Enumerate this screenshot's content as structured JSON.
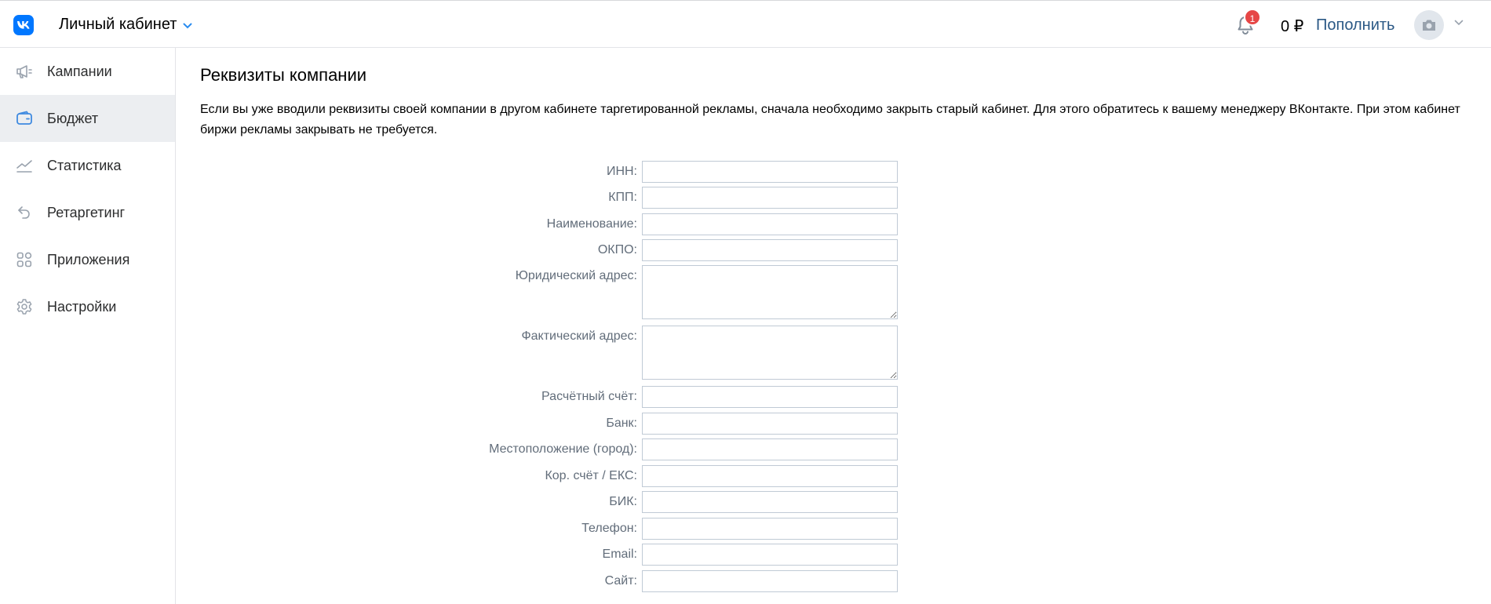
{
  "header": {
    "cabinet_title": "Личный кабинет",
    "notification_count": "1",
    "balance": "0 ₽",
    "topup_label": "Пополнить"
  },
  "sidebar": {
    "items": [
      {
        "label": "Кампании",
        "icon": "megaphone-icon"
      },
      {
        "label": "Бюджет",
        "icon": "wallet-icon",
        "active": true
      },
      {
        "label": "Статистика",
        "icon": "chart-line-icon"
      },
      {
        "label": "Ретаргетинг",
        "icon": "retarget-arrow-icon"
      },
      {
        "label": "Приложения",
        "icon": "apps-grid-icon"
      },
      {
        "label": "Настройки",
        "icon": "gear-icon"
      }
    ]
  },
  "main": {
    "title": "Реквизиты компании",
    "notice": "Если вы уже вводили реквизиты своей компании в другом кабинете таргетированной рекламы, сначала необходимо закрыть старый кабинет. Для этого обратитесь к вашему менеджеру ВКонтакте. При этом кабинет биржи рекламы закрывать не требуется.",
    "form": {
      "inn": {
        "label": "ИНН:",
        "value": ""
      },
      "kpp": {
        "label": "КПП:",
        "value": ""
      },
      "name": {
        "label": "Наименование:",
        "value": ""
      },
      "okpo": {
        "label": "ОКПО:",
        "value": ""
      },
      "legal_address": {
        "label": "Юридический адрес:",
        "value": ""
      },
      "actual_address": {
        "label": "Фактический адрес:",
        "value": ""
      },
      "account": {
        "label": "Расчётный счёт:",
        "value": ""
      },
      "bank": {
        "label": "Банк:",
        "value": ""
      },
      "city": {
        "label": "Местоположение (город):",
        "value": ""
      },
      "corr_account": {
        "label": "Кор. счёт / ЕКС:",
        "value": ""
      },
      "bik": {
        "label": "БИК:",
        "value": ""
      },
      "phone": {
        "label": "Телефон:",
        "value": ""
      },
      "email": {
        "label": "Email:",
        "value": ""
      },
      "site": {
        "label": "Сайт:",
        "value": ""
      }
    }
  },
  "colors": {
    "accent": "#0077ff",
    "link": "#2a5885",
    "badge": "#e64646",
    "active_nav_bg": "#eceef1"
  }
}
